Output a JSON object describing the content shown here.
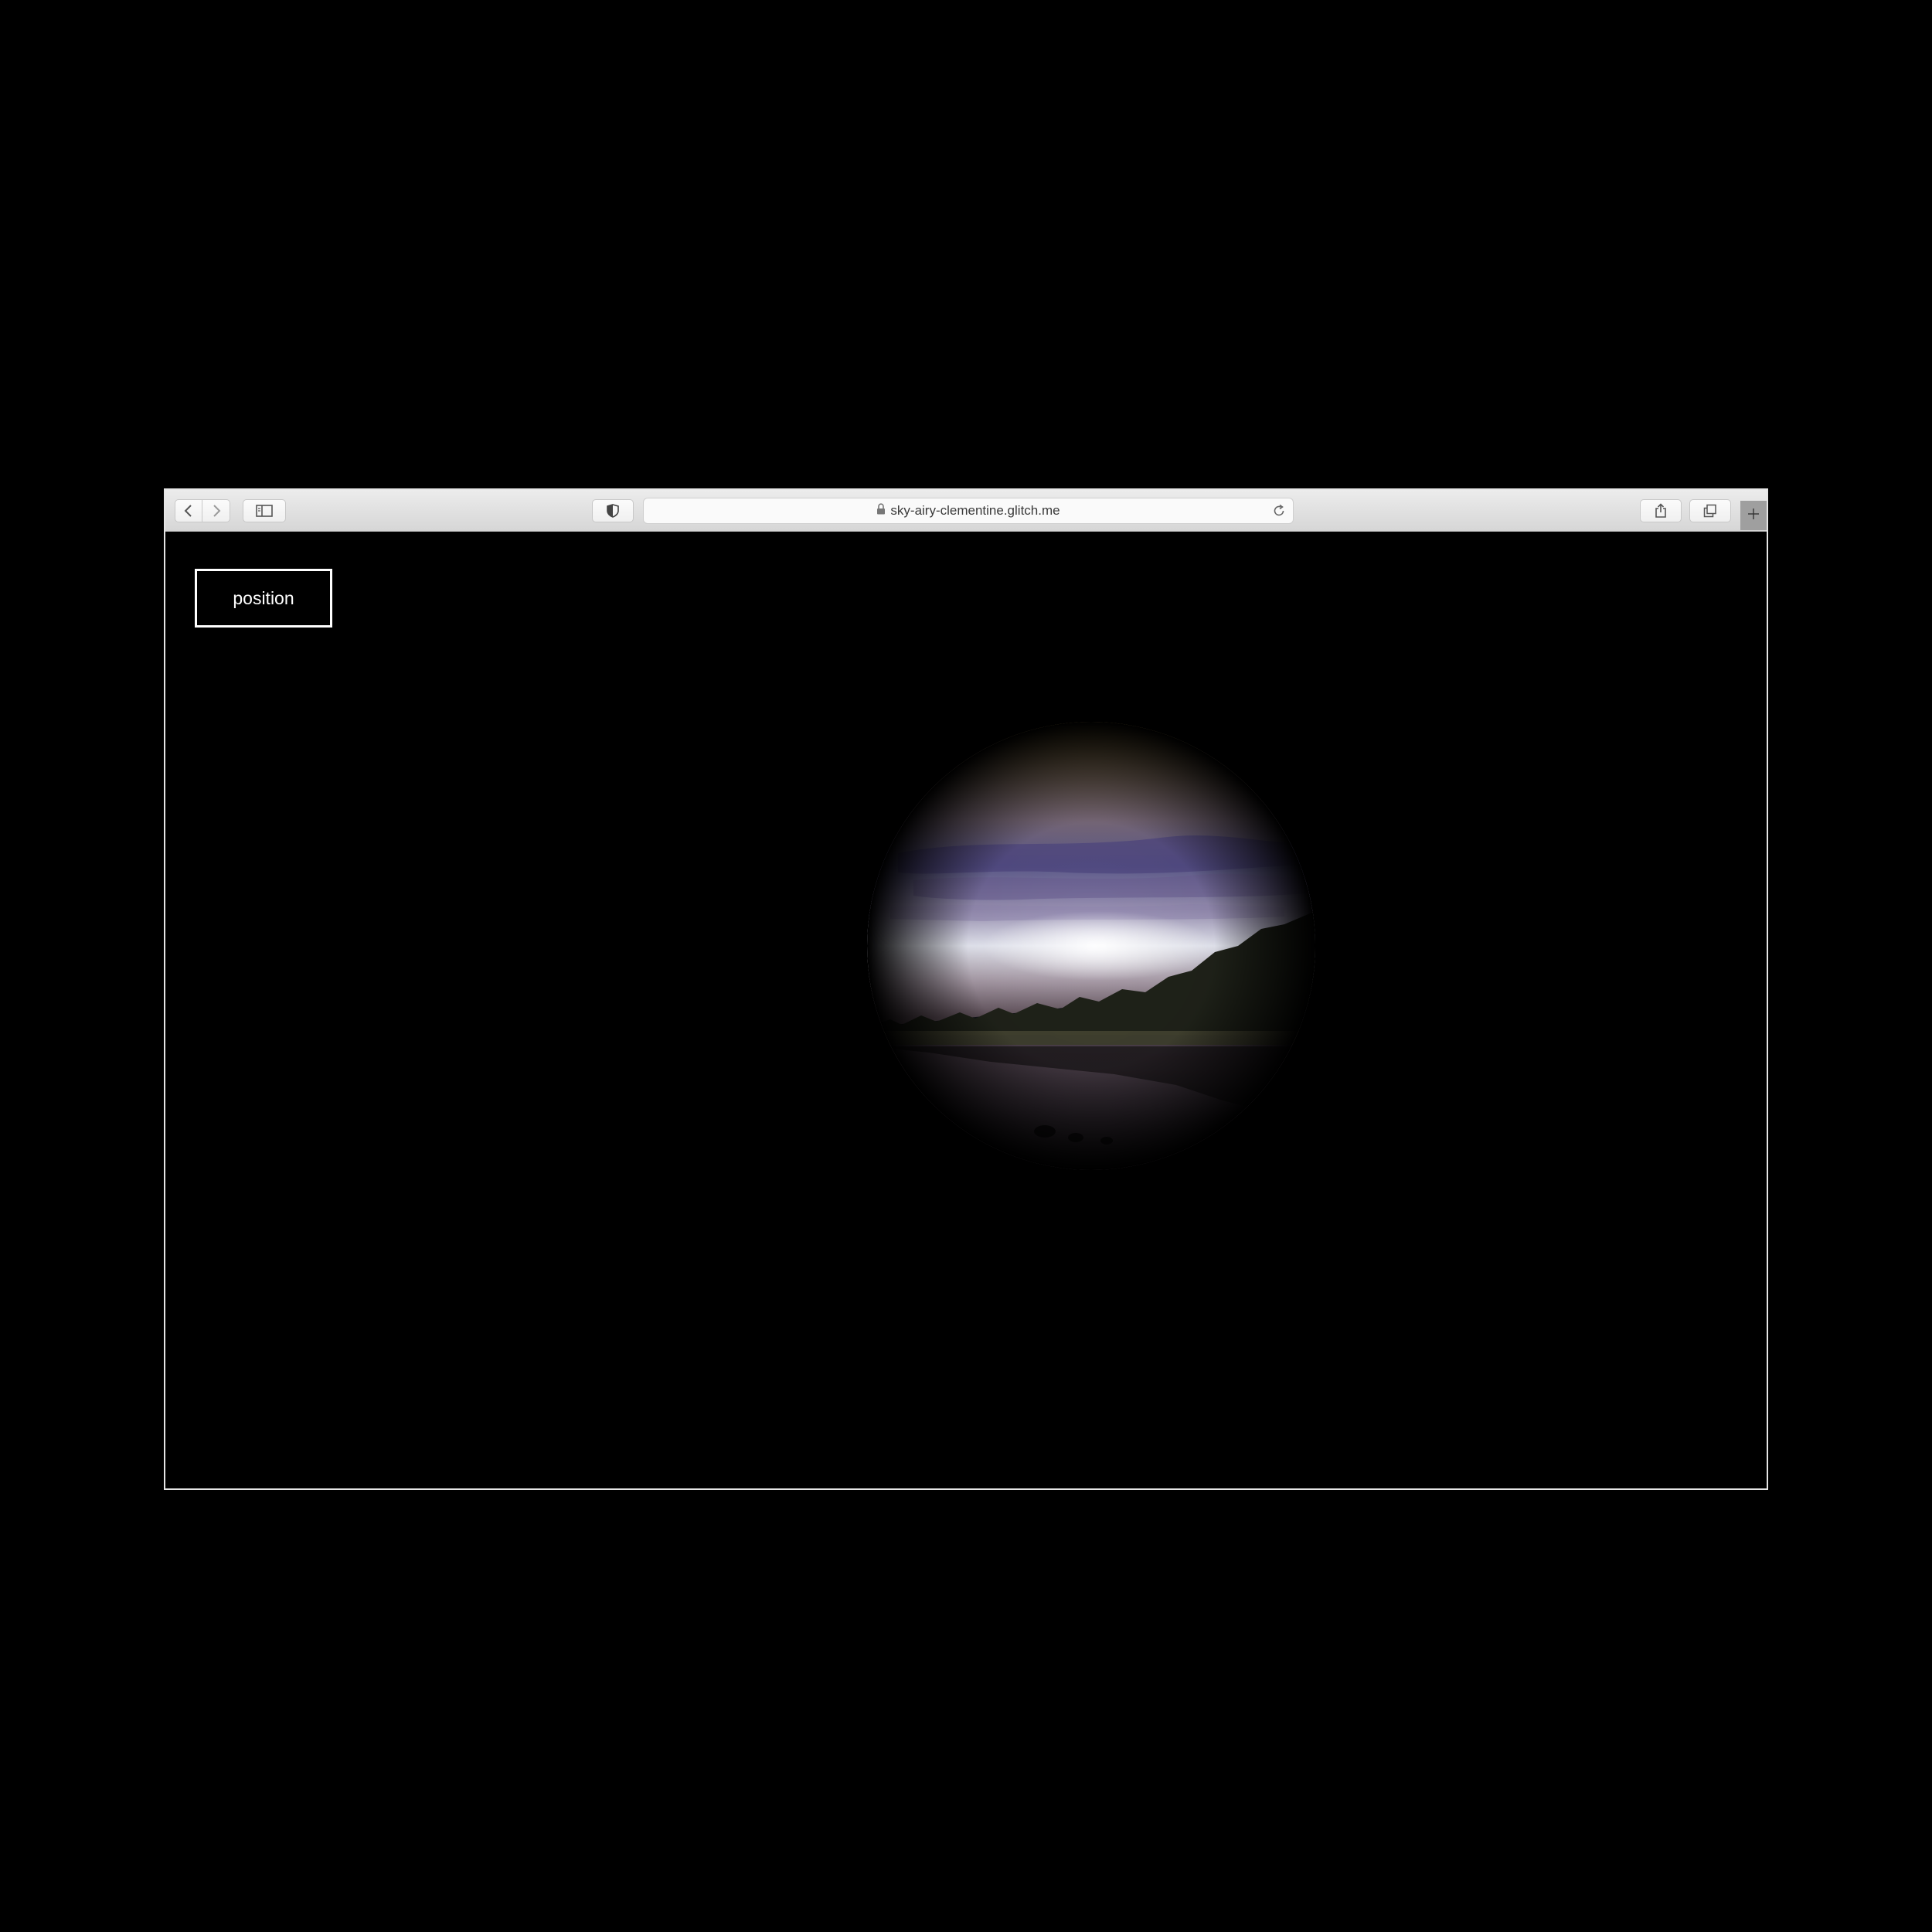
{
  "browser": {
    "url": "sky-airy-clementine.glitch.me"
  },
  "page": {
    "position_button_label": "position"
  },
  "colors": {
    "background": "#000000",
    "toolbar": "#dcdcdc",
    "button_border": "#ffffff"
  }
}
